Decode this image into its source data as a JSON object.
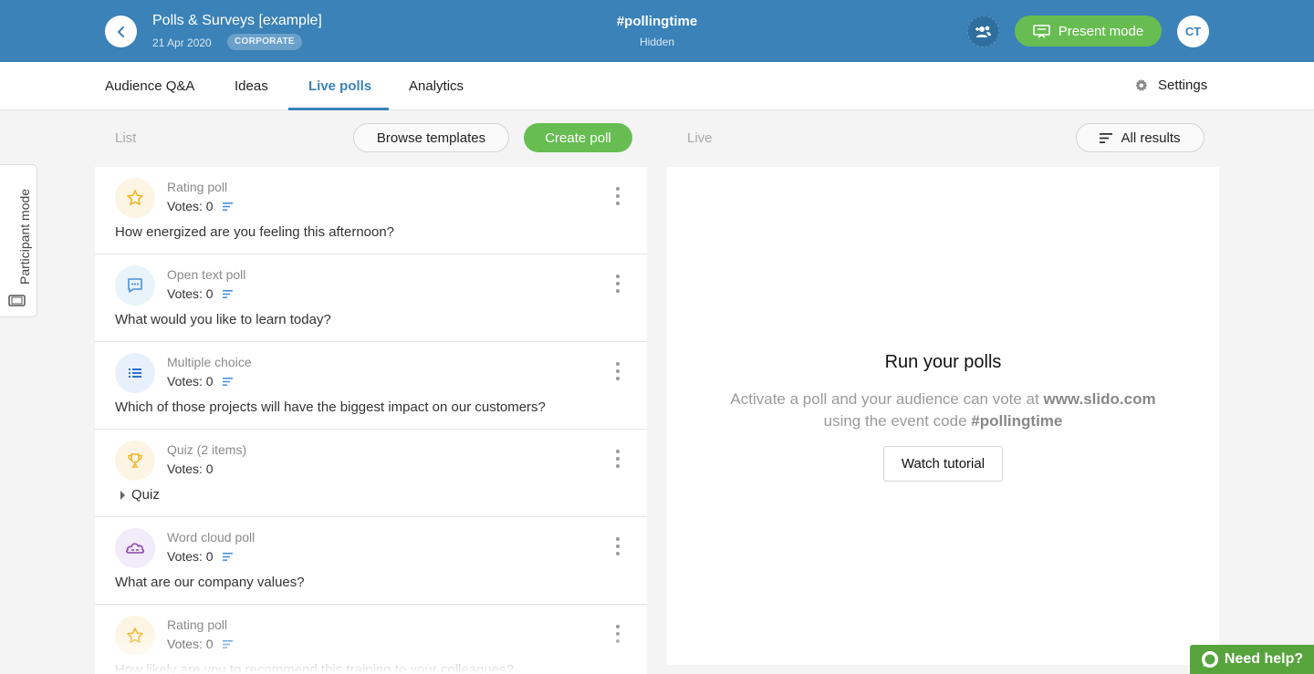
{
  "header": {
    "title": "Polls & Surveys [example]",
    "date": "21 Apr 2020",
    "plan_badge": "CORPORATE",
    "event_code": "#pollingtime",
    "event_status": "Hidden",
    "present_label": "Present mode",
    "avatar_initials": "CT"
  },
  "tabs": [
    {
      "label": "Audience Q&A"
    },
    {
      "label": "Ideas"
    },
    {
      "label": "Live polls",
      "active": true
    },
    {
      "label": "Analytics"
    }
  ],
  "settings_label": "Settings",
  "toolbar": {
    "list_label": "List",
    "browse_label": "Browse templates",
    "create_label": "Create poll",
    "live_label": "Live",
    "results_label": "All results"
  },
  "side_tab": {
    "label": "Participant mode"
  },
  "polls": [
    {
      "type": "Rating poll",
      "votes": "Votes: 0",
      "question": "How energized are you feeling this afternoon?",
      "icon": "star-icon"
    },
    {
      "type": "Open text poll",
      "votes": "Votes: 0",
      "question": "What would you like to learn today?",
      "icon": "speech-bubble-icon"
    },
    {
      "type": "Multiple choice",
      "votes": "Votes: 0",
      "question": "Which of those projects will have the biggest impact on our customers?",
      "icon": "list-icon"
    },
    {
      "type": "Quiz (2 items)",
      "votes": "Votes: 0",
      "toggle_label": "Quiz",
      "icon": "trophy-icon"
    },
    {
      "type": "Word cloud poll",
      "votes": "Votes: 0",
      "question": "What are our company values?",
      "icon": "cloud-icon"
    },
    {
      "type": "Rating poll",
      "votes": "Votes: 0",
      "question": "How likely are you to recommend this training to your colleagues?",
      "icon": "star-icon"
    }
  ],
  "live_panel": {
    "title": "Run your polls",
    "desc_part1": "Activate a poll and your audience can vote at ",
    "desc_site": "www.slido.com",
    "desc_part2": "using the event code ",
    "desc_code": "#pollingtime",
    "tutorial_label": "Watch tutorial"
  },
  "help_label": "Need help?",
  "colors": {
    "header_blue": "#3a82b8",
    "green": "#67bd51",
    "help_green": "#57a43d"
  }
}
